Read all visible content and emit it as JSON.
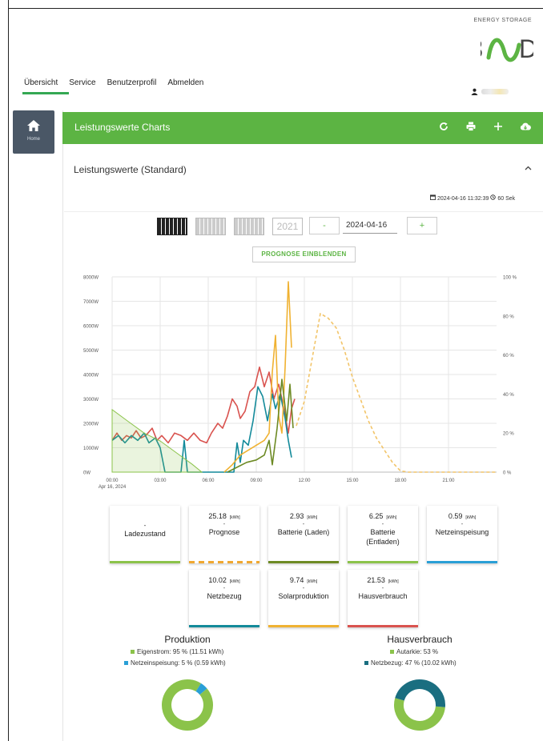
{
  "logo": {
    "tagline": "ENERGY STORAGE",
    "brand": "E3/DC"
  },
  "nav": {
    "items": [
      "Übersicht",
      "Service",
      "Benutzerprofil",
      "Abmelden"
    ],
    "active": "Übersicht"
  },
  "sidebar": {
    "home_label": "Home"
  },
  "header": {
    "title": "Leistungswerte Charts"
  },
  "panel": {
    "title": "Leistungswerte (Standard)",
    "timestamp": "2024-04-16 11:32:39",
    "refresh": "60 Sek"
  },
  "controls": {
    "year_label": "2021",
    "prev": "-",
    "next": "+",
    "date_value": "2024-04-16",
    "prognose_button": "PROGNOSE EINBLENDEN"
  },
  "colors": {
    "accent": "#5cb443",
    "sidebar": "#4a5766",
    "red": "#d9534f",
    "teal": "#138a9a",
    "yellow": "#f0b232",
    "olive": "#6d8a24",
    "orange_dashed": "#f2c468",
    "blue": "#2a9fd6"
  },
  "chart_data": {
    "type": "line",
    "x_ticks": [
      "00:00",
      "03:00",
      "06:00",
      "09:00",
      "12:00",
      "15:00",
      "18:00",
      "21:00"
    ],
    "x_date_label": "Apr 16, 2024",
    "y_ticks": [
      "0W",
      "1000W",
      "2000W",
      "3000W",
      "4000W",
      "5000W",
      "6000W",
      "7000W",
      "8000W"
    ],
    "y2_ticks": [
      "0 %",
      "20 %",
      "40 %",
      "60 %",
      "80 %",
      "100 %"
    ],
    "xlim_hours": [
      0,
      24
    ],
    "ylim": [
      0,
      8000
    ],
    "y2lim": [
      0,
      100
    ],
    "grid": true,
    "series": [
      {
        "color": "#d9534f",
        "points": [
          [
            0,
            1300
          ],
          [
            0.3,
            1600
          ],
          [
            0.6,
            1300
          ],
          [
            0.9,
            1500
          ],
          [
            1.2,
            1400
          ],
          [
            1.5,
            1700
          ],
          [
            1.8,
            1400
          ],
          [
            2.1,
            1500
          ],
          [
            2.5,
            1800
          ],
          [
            2.8,
            1300
          ],
          [
            3.1,
            1500
          ],
          [
            3.5,
            1200
          ],
          [
            3.9,
            1600
          ],
          [
            4.3,
            1500
          ],
          [
            4.7,
            1300
          ],
          [
            5.1,
            1600
          ],
          [
            5.5,
            1300
          ],
          [
            5.9,
            1200
          ],
          [
            6.2,
            1600
          ],
          [
            6.6,
            2000
          ],
          [
            6.9,
            1800
          ],
          [
            7.2,
            2300
          ],
          [
            7.5,
            3000
          ],
          [
            7.8,
            2700
          ],
          [
            8.0,
            2200
          ],
          [
            8.3,
            2500
          ],
          [
            8.6,
            3300
          ],
          [
            8.9,
            3500
          ],
          [
            9.2,
            4300
          ],
          [
            9.5,
            3500
          ],
          [
            9.8,
            4100
          ],
          [
            10.1,
            3000
          ],
          [
            10.4,
            3600
          ],
          [
            10.7,
            2700
          ],
          [
            11.0,
            1600
          ],
          [
            11.2,
            2600
          ],
          [
            11.4,
            3000
          ]
        ]
      },
      {
        "color": "#138a9a",
        "points": [
          [
            0,
            1300
          ],
          [
            0.4,
            1500
          ],
          [
            0.8,
            1200
          ],
          [
            1.2,
            1500
          ],
          [
            1.6,
            1300
          ],
          [
            2.0,
            1600
          ],
          [
            2.3,
            1200
          ],
          [
            2.7,
            1400
          ],
          [
            3.0,
            1000
          ],
          [
            3.3,
            0
          ],
          [
            4.3,
            0
          ],
          [
            4.5,
            1300
          ],
          [
            4.7,
            0
          ],
          [
            7.6,
            0
          ],
          [
            7.8,
            1200
          ],
          [
            8.0,
            400
          ],
          [
            8.2,
            1300
          ],
          [
            8.5,
            1100
          ],
          [
            8.8,
            2100
          ],
          [
            9.1,
            3500
          ],
          [
            9.4,
            3100
          ],
          [
            9.7,
            2100
          ],
          [
            10.0,
            3200
          ],
          [
            10.2,
            2600
          ],
          [
            10.5,
            3200
          ],
          [
            10.8,
            2200
          ],
          [
            11.0,
            1300
          ],
          [
            11.2,
            600
          ]
        ]
      },
      {
        "color": "#f0b232",
        "points": [
          [
            7.0,
            0
          ],
          [
            7.5,
            300
          ],
          [
            8.0,
            700
          ],
          [
            8.5,
            900
          ],
          [
            9.0,
            1100
          ],
          [
            9.5,
            1300
          ],
          [
            9.8,
            1600
          ],
          [
            10.0,
            4100
          ],
          [
            10.2,
            5600
          ],
          [
            10.4,
            2300
          ],
          [
            10.6,
            1600
          ],
          [
            10.8,
            4300
          ],
          [
            11.0,
            7800
          ],
          [
            11.2,
            5100
          ]
        ]
      },
      {
        "color": "#6d8a24",
        "points": [
          [
            7.2,
            0
          ],
          [
            7.8,
            200
          ],
          [
            8.4,
            400
          ],
          [
            9.0,
            500
          ],
          [
            9.5,
            700
          ],
          [
            9.8,
            1300
          ],
          [
            10.0,
            300
          ],
          [
            10.3,
            1800
          ],
          [
            10.6,
            3800
          ],
          [
            10.9,
            2100
          ],
          [
            11.1,
            3600
          ],
          [
            11.3,
            1800
          ]
        ]
      },
      {
        "color": "#f2c468",
        "dashed": true,
        "points": [
          [
            11.5,
            1900
          ],
          [
            12.0,
            2900
          ],
          [
            12.5,
            4700
          ],
          [
            13.0,
            6500
          ],
          [
            13.5,
            6300
          ],
          [
            14.0,
            5900
          ],
          [
            14.5,
            5000
          ],
          [
            15.0,
            3900
          ],
          [
            15.5,
            3000
          ],
          [
            16.0,
            2100
          ],
          [
            16.5,
            1400
          ],
          [
            17.0,
            900
          ],
          [
            17.5,
            400
          ],
          [
            18.0,
            50
          ],
          [
            18.5,
            0
          ],
          [
            24,
            0
          ]
        ]
      },
      {
        "color": "#8bc34a",
        "area": true,
        "axis": "y2",
        "points": [
          [
            0,
            32
          ],
          [
            1,
            26
          ],
          [
            2,
            20
          ],
          [
            3,
            16
          ],
          [
            4,
            10
          ],
          [
            5,
            4
          ],
          [
            5.6,
            0
          ]
        ]
      }
    ]
  },
  "cards": [
    {
      "value": "",
      "unit": "",
      "label": "Ladezustand",
      "color": "#8bc34a",
      "dashed": false
    },
    {
      "value": "25.18",
      "unit": "[kWh]",
      "label": "Prognose",
      "color": "#f0a830",
      "dashed": true
    },
    {
      "value": "2.93",
      "unit": "[kWh]",
      "label": "Batterie (Laden)",
      "color": "#6d8a24",
      "dashed": false
    },
    {
      "value": "6.25",
      "unit": "[kWh]",
      "label": "Batterie (Entladen)",
      "color": "#8bc34a",
      "dashed": false
    },
    {
      "value": "0.59",
      "unit": "[kWh]",
      "label": "Netzeinspeisung",
      "color": "#2a9fd6",
      "dashed": false
    },
    {
      "value": "10.02",
      "unit": "[kWh]",
      "label": "Netzbezug",
      "color": "#138a9a",
      "dashed": false
    },
    {
      "value": "9.74",
      "unit": "[kWh]",
      "label": "Solarproduktion",
      "color": "#f0b232",
      "dashed": false
    },
    {
      "value": "21.53",
      "unit": "[kWh]",
      "label": "Hausverbrauch",
      "color": "#d9534f",
      "dashed": false
    }
  ],
  "production": {
    "title": "Produktion",
    "legend": [
      "Eigenstrom: 95 % (11.51 kWh)",
      "Netzeinspeisung: 5 % (0.59 kWh)"
    ],
    "shares": [
      95,
      5
    ],
    "colors": [
      "#8bc34a",
      "#2a9fd6"
    ]
  },
  "consumption": {
    "title": "Hausverbrauch",
    "legend": [
      "Autarkie: 53 %",
      "Netzbezug: 47 % (10.02 kWh)"
    ],
    "shares": [
      53,
      47
    ],
    "colors": [
      "#8bc34a",
      "#1a6e80"
    ]
  }
}
